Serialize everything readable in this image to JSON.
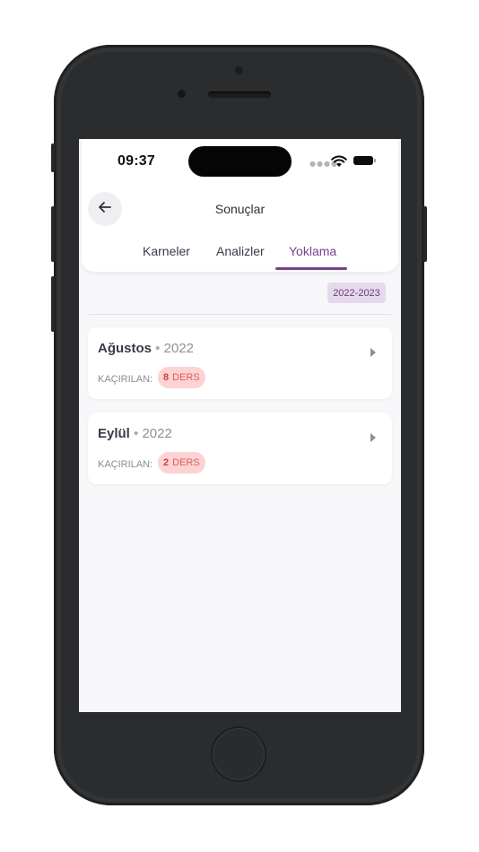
{
  "status_bar": {
    "time": "09:37",
    "signal_icon": "cellular-dots-icon",
    "wifi_icon": "wifi-icon",
    "battery_icon": "battery-icon"
  },
  "header": {
    "title": "Sonuçlar",
    "back_icon": "arrow-left-icon"
  },
  "tabs": [
    {
      "label": "Karneler",
      "active": false
    },
    {
      "label": "Analizler",
      "active": false
    },
    {
      "label": "Yoklama",
      "active": true
    }
  ],
  "year_filter": "2022-2023",
  "months": [
    {
      "name": "Ağustos",
      "separator": "•",
      "year": "2022",
      "missed_label": "KAÇIRILAN:",
      "missed_count": "8",
      "missed_unit": "DERS"
    },
    {
      "name": "Eylül",
      "separator": "•",
      "year": "2022",
      "missed_label": "KAÇIRILAN:",
      "missed_count": "2",
      "missed_unit": "DERS"
    }
  ],
  "colors": {
    "accent": "#7a3f8f",
    "badge_bg": "#e6d9ec",
    "missed_bg": "#fcd3d3",
    "missed_text": "#d63a3a"
  }
}
